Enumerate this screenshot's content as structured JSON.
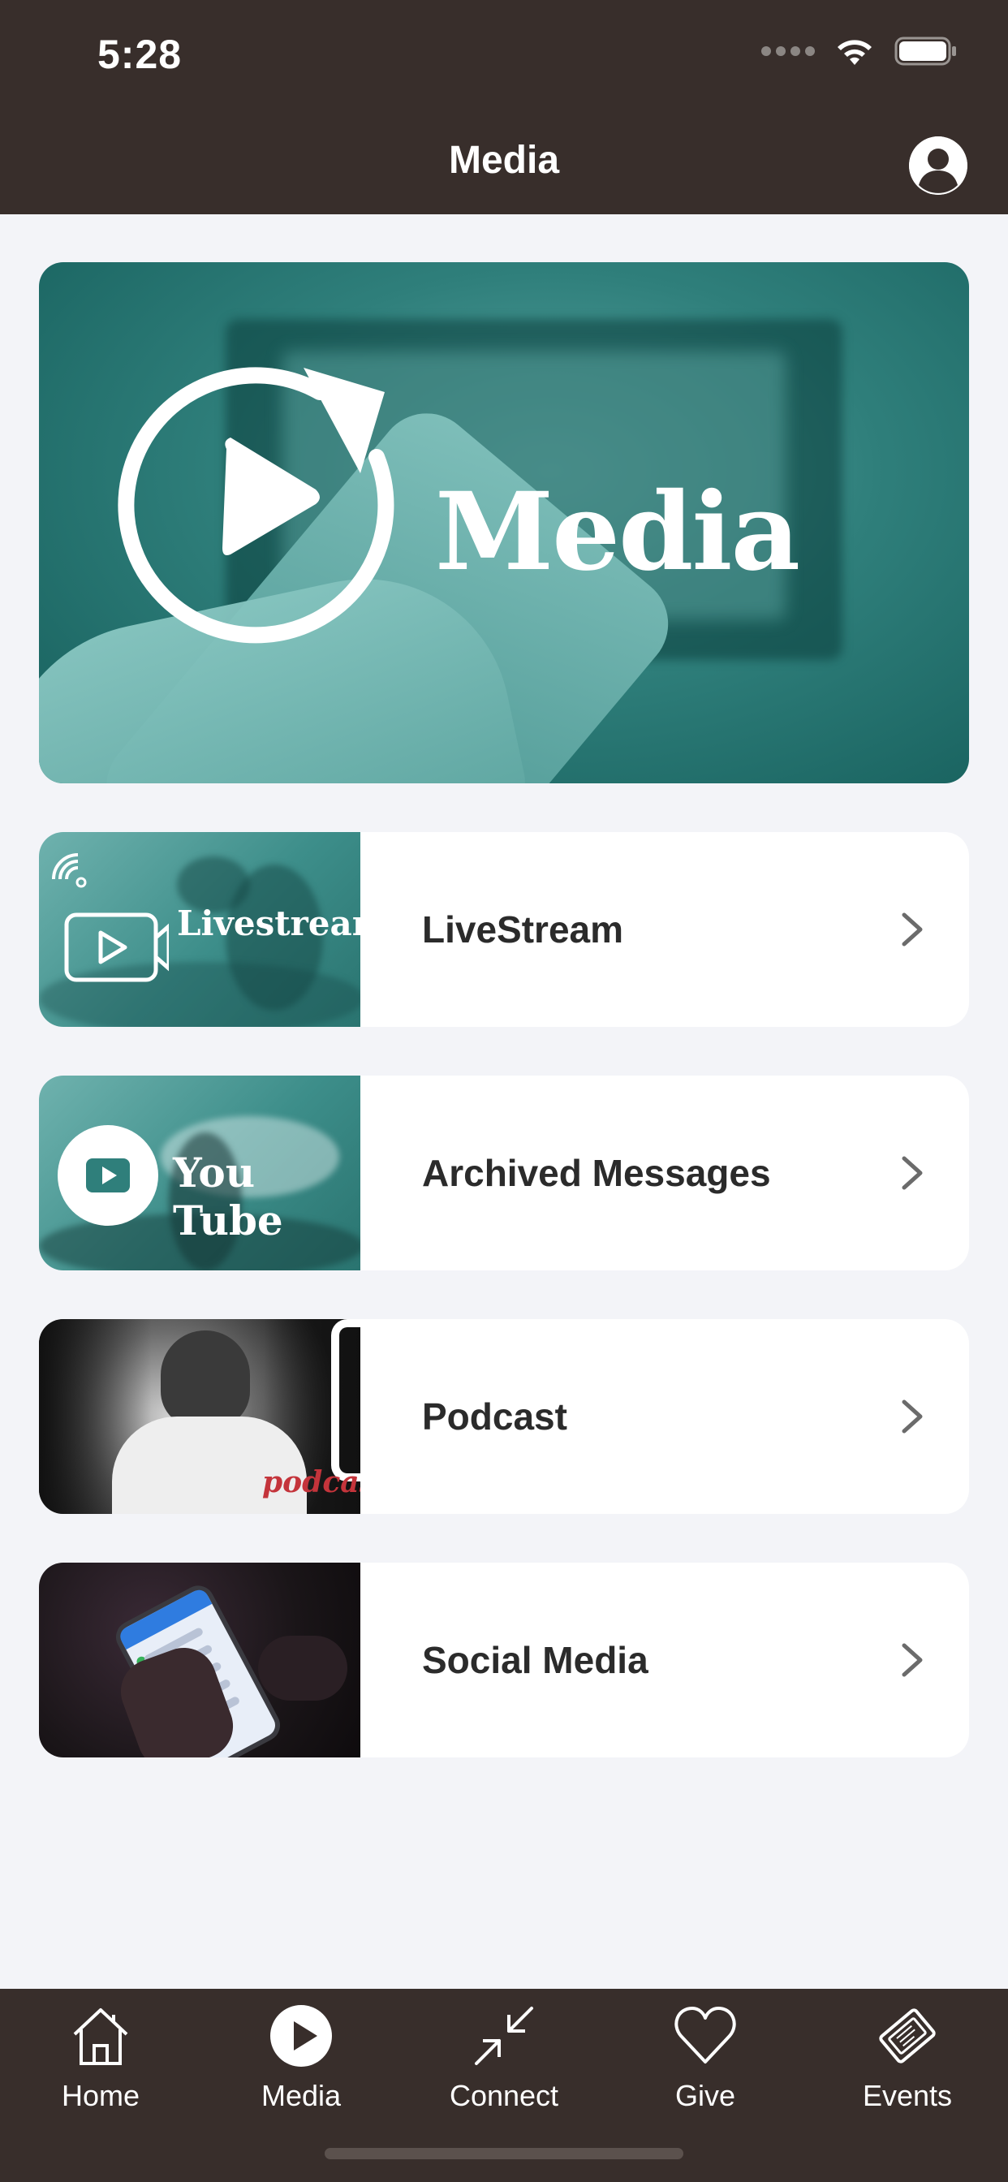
{
  "status_bar": {
    "time": "5:28"
  },
  "header": {
    "title": "Media",
    "profile_icon": "person-circle-icon"
  },
  "hero": {
    "title": "Media",
    "icon": "replay-play-icon"
  },
  "media_items": [
    {
      "label": "LiveStream",
      "thumb_text": "Livestream",
      "icon": "video-camera-icon"
    },
    {
      "label": "Archived Messages",
      "thumb_text": "You Tube",
      "icon": "youtube-play-icon"
    },
    {
      "label": "Podcast",
      "thumb_text": "podcast",
      "icon": "photo"
    },
    {
      "label": "Social Media",
      "thumb_text": "",
      "icon": "photo"
    }
  ],
  "tabbar": {
    "items": [
      {
        "label": "Home",
        "icon": "house-icon",
        "active": false
      },
      {
        "label": "Media",
        "icon": "play-circle-icon",
        "active": true
      },
      {
        "label": "Connect",
        "icon": "arrows-in-icon",
        "active": false
      },
      {
        "label": "Give",
        "icon": "heart-icon",
        "active": false
      },
      {
        "label": "Events",
        "icon": "ticket-icon",
        "active": false
      }
    ]
  },
  "colors": {
    "bar_background": "#382e2b",
    "page_background": "#f3f4f8",
    "teal": "#2f7f7b",
    "text_dark": "#2b2b2b",
    "chevron": "#6b6b6b"
  }
}
